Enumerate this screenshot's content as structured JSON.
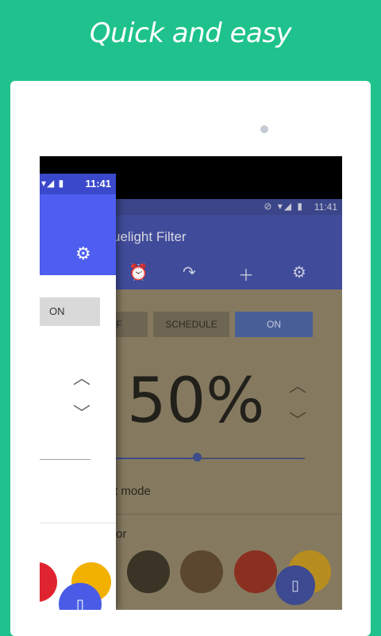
{
  "headline": "Quick and easy",
  "back_app": {
    "status_time": "11:41",
    "status_icons": "⊘ ▾◢ ▮",
    "title": "uelight Filter",
    "toolbar_icons": [
      "alarm-icon",
      "redo-icon",
      "add-icon",
      "settings-icon"
    ],
    "segments": {
      "off": "F",
      "schedule": "SCHEDULE",
      "on": "ON"
    },
    "percent": "50%",
    "slider_value": 0.5,
    "mode_label": "t mode",
    "color_label": "or",
    "swatch_colors": [
      "#3a3427",
      "#5b4730",
      "#8b3020",
      "#b88d1f"
    ]
  },
  "front_card": {
    "status_time": "11:41",
    "status_icons": "▾◢ ▮",
    "on_label": "ON",
    "swatch_colors": [
      "#e0242f",
      "#f2b100"
    ]
  },
  "colors": {
    "background": "#1fc28c",
    "accent": "#4e5ef0"
  }
}
